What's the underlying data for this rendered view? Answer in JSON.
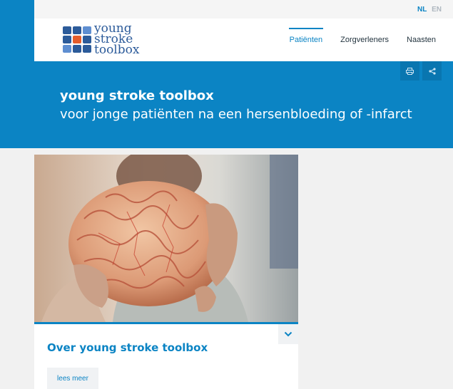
{
  "language": {
    "nl": "NL",
    "en": "EN"
  },
  "logo": {
    "line1": "young",
    "line2": "stroke",
    "line3": "toolbox"
  },
  "nav": {
    "patients": "Patiënten",
    "caregivers": "Zorgverleners",
    "relatives": "Naasten"
  },
  "hero": {
    "title": "young stroke toolbox",
    "subtitle": "voor jonge patiënten na een hersenbloeding of -infarct"
  },
  "tools": {
    "print_icon": "printer-icon",
    "share_icon": "share-icon"
  },
  "card": {
    "image": "hands-holding-brain-model",
    "title": "Over young stroke toolbox",
    "button": "lees meer"
  },
  "colors": {
    "brand": "#0b84c4",
    "logo_blue": "#2c5b9a",
    "logo_orange": "#e55d2c"
  }
}
